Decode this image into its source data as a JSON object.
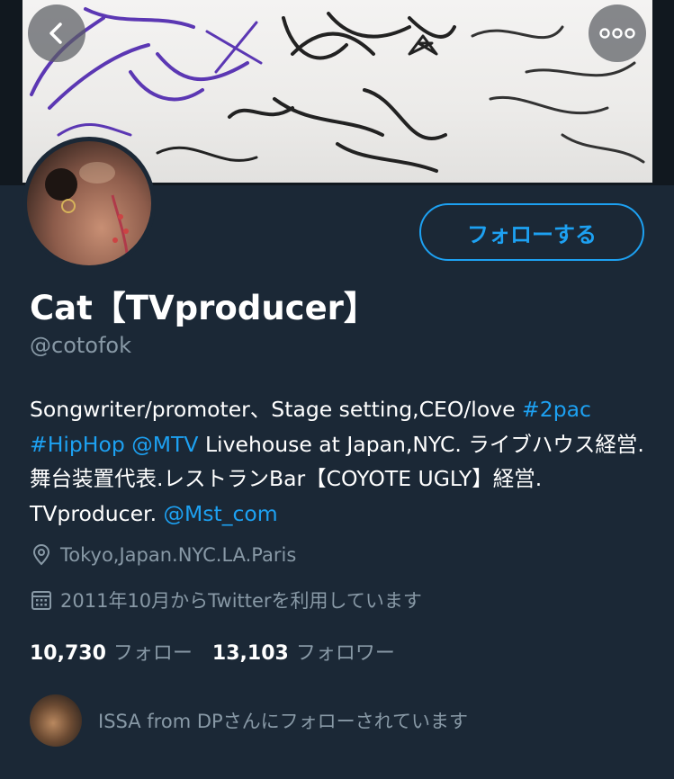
{
  "nav": {
    "back_icon": "chevron-left-icon",
    "more_icon": "more-horizontal-icon"
  },
  "profile": {
    "name": "Cat【TVproducer】",
    "handle": "@cotofok",
    "follow_button_label": "フォローする"
  },
  "bio": {
    "text1": "Songwriter/promoter、Stage setting,CEO/love ",
    "hashtag1": "#2pac",
    "hashtag2": "#HipHop",
    "mention1": "@MTV",
    "text2": " Livehouse at Japan,NYC. ライブハウス経営.舞台装置代表.レストランBar【COYOTE UGLY】経営. TVproducer. ",
    "mention2": "@Mst_com"
  },
  "meta": {
    "location_icon": "location-pin-icon",
    "location": "Tokyo,Japan.NYC.LA.Paris",
    "calendar_icon": "calendar-icon",
    "joined": "2011年10月からTwitterを利用しています"
  },
  "stats": {
    "following_count": "10,730",
    "following_label": "フォロー",
    "followers_count": "13,103",
    "followers_label": "フォロワー"
  },
  "followed_by": {
    "text": "ISSA from DPさんにフォローされています"
  },
  "colors": {
    "background": "#1b2836",
    "accent": "#1da1f2",
    "secondary_text": "#8899a6"
  }
}
